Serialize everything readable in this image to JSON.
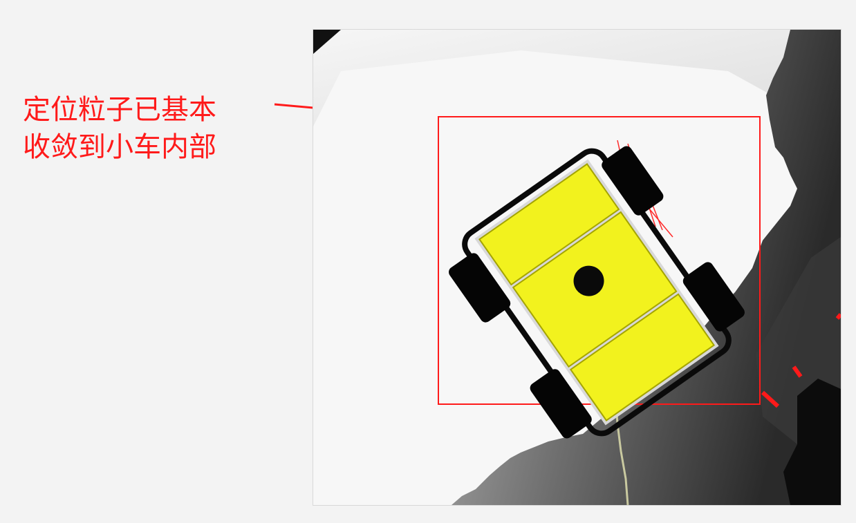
{
  "annotation": {
    "lines": [
      "定位粒子已基本",
      "收敛到小车内部"
    ],
    "color": "#ff1a1a"
  },
  "map": {
    "highlight_color": "#ff1a1a",
    "robot_color": "#f2f21e",
    "particle_color": "#ff2a2a"
  }
}
